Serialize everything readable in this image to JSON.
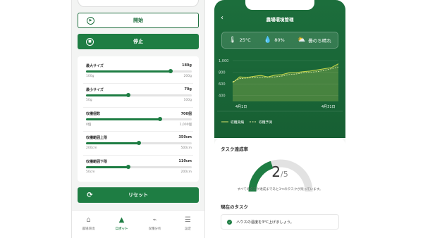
{
  "left": {
    "start_button": "開始",
    "stop_button": "停止",
    "sliders": [
      {
        "label": "最大サイズ",
        "value": "180g",
        "min": "100g",
        "max": "200g",
        "fraction": 0.8
      },
      {
        "label": "最小サイズ",
        "value": "70g",
        "min": "50g",
        "max": "100g",
        "fraction": 0.4
      },
      {
        "label": "収穫個数",
        "value": "700個",
        "min": "0個",
        "max": "1,000個",
        "fraction": 0.7
      },
      {
        "label": "収穫範囲上限",
        "value": "350cm",
        "min": "200cm",
        "max": "500cm",
        "fraction": 0.5
      },
      {
        "label": "収穫範囲下限",
        "value": "110cm",
        "min": "50cm",
        "max": "200cm",
        "fraction": 0.4
      }
    ],
    "reset_button": "リセット",
    "nav": [
      {
        "label": "農場環境",
        "icon": "home-icon"
      },
      {
        "label": "ロボット",
        "icon": "robot-icon",
        "active": true
      },
      {
        "label": "収穫分析",
        "icon": "chart-icon"
      },
      {
        "label": "設定",
        "icon": "settings-icon"
      }
    ]
  },
  "right": {
    "title": "農場環境管理",
    "weather": {
      "temp": "25°C",
      "humidity": "80%",
      "forecast": "曇のち晴れ"
    },
    "chart_data": {
      "type": "line",
      "yticks": [
        "1,000",
        "800",
        "600",
        "400"
      ],
      "ylim": [
        300,
        1000
      ],
      "x_labels": [
        "4月1日",
        "4月31日"
      ],
      "series": [
        {
          "name": "収穫実績",
          "values": [
            620,
            720,
            710,
            730,
            745,
            720,
            750,
            760,
            790,
            795,
            810,
            820,
            840,
            860,
            880,
            945
          ]
        },
        {
          "name": "収穫予測",
          "values": [
            640,
            690,
            700,
            705,
            710,
            715,
            720,
            735,
            760,
            770,
            790,
            800,
            810,
            830,
            860,
            890
          ]
        }
      ],
      "colors": {
        "actual": "#d9e26a",
        "forecast": "#e9f0a8",
        "line": "#c8d84a"
      }
    },
    "task": {
      "title": "タスク達成率",
      "done": "2",
      "slash": "/",
      "total": "5",
      "fraction": 0.4,
      "message": "すべてのタスク達成まであと3つのタスクが残っています。"
    },
    "current": {
      "title": "現在のタスク",
      "item": "ハウスの温度を3°C上げましょう。"
    }
  }
}
